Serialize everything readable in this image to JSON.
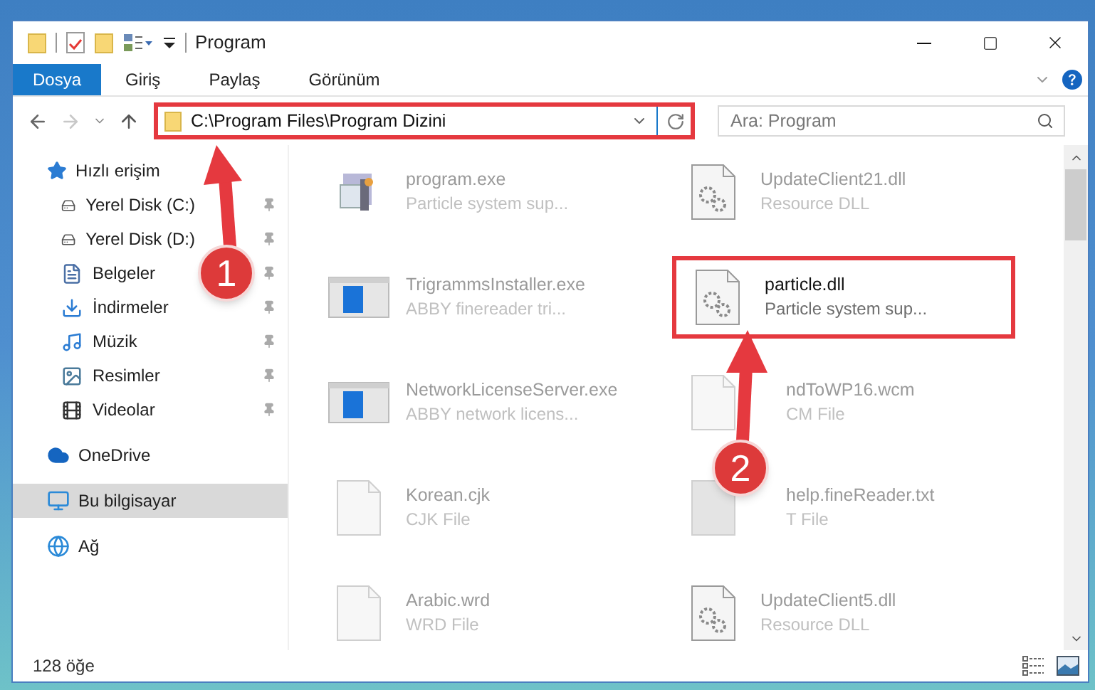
{
  "window": {
    "title": "Program"
  },
  "ribbon_tabs": [
    {
      "label": "Dosya",
      "selected": true
    },
    {
      "label": "Giriş",
      "selected": false
    },
    {
      "label": "Paylaş",
      "selected": false
    },
    {
      "label": "Görünüm",
      "selected": false
    }
  ],
  "address_bar": {
    "value": "C:\\Program Files\\Program Dizini",
    "highlighted": true
  },
  "search": {
    "placeholder": "Ara: Program"
  },
  "sidebar": {
    "items": [
      {
        "label": "Hızlı erişim",
        "selected": false,
        "children": [
          {
            "label": "Yerel Disk (C:)",
            "selected": false,
            "pinned": true
          },
          {
            "label": "Yerel Disk (D:)",
            "selected": false,
            "pinned": true
          },
          {
            "label": "Belgeler",
            "selected": false,
            "pinned": true
          },
          {
            "label": "İndirmeler",
            "selected": false,
            "pinned": true
          },
          {
            "label": "Müzik",
            "selected": false,
            "pinned": true
          },
          {
            "label": "Resimler",
            "selected": false,
            "pinned": true
          },
          {
            "label": "Videolar",
            "selected": false,
            "pinned": true
          }
        ]
      },
      {
        "label": "OneDrive",
        "selected": false
      },
      {
        "label": "Bu bilgisayar",
        "selected": true
      },
      {
        "label": "Ağ",
        "selected": false
      }
    ]
  },
  "files": [
    {
      "kind": "app",
      "name": "program.exe",
      "description": "Particle system sup...",
      "highlighted": false
    },
    {
      "kind": "dll",
      "name": "UpdateClient21.dll",
      "description": "Resource DLL",
      "highlighted": false
    },
    {
      "kind": "window",
      "name": "TrigrammsInstaller.exe",
      "description": "ABBY finereader tri...",
      "highlighted": false
    },
    {
      "kind": "dll",
      "name": "particle.dll",
      "description": "Particle system sup...",
      "highlighted": true
    },
    {
      "kind": "window",
      "name": "NetworkLicenseServer.exe",
      "description": "ABBY network licens...",
      "highlighted": false
    },
    {
      "kind": "doc",
      "name": "ndToWP16.wcm",
      "description": "CM File",
      "highlighted": false
    },
    {
      "kind": "doc",
      "name": "Korean.cjk",
      "description": "CJK File",
      "highlighted": false
    },
    {
      "kind": "grey",
      "name": "help.fineReader.txt",
      "description": "T File",
      "highlighted": false
    },
    {
      "kind": "doc",
      "name": "Arabic.wrd",
      "description": "WRD File",
      "highlighted": false
    },
    {
      "kind": "dll",
      "name": "UpdateClient5.dll",
      "description": "Resource DLL",
      "highlighted": false
    }
  ],
  "status_bar": {
    "item_count": "128 öğe"
  },
  "callouts": [
    {
      "number": "1"
    },
    {
      "number": "2"
    }
  ]
}
